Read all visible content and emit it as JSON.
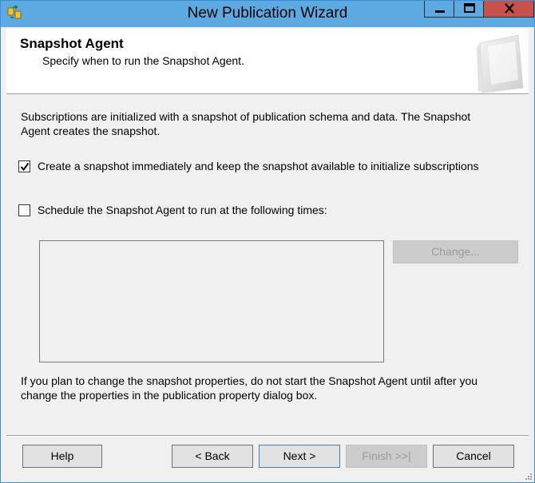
{
  "window": {
    "title": "New Publication Wizard",
    "accent_color": "#5da9e1",
    "close_color": "#c7514b",
    "controls": [
      "minimize-icon",
      "maximize-icon",
      "close-icon"
    ]
  },
  "header": {
    "title": "Snapshot Agent",
    "subtitle": "Specify when to run the Snapshot Agent."
  },
  "content": {
    "intro": "Subscriptions are initialized with a snapshot of publication schema and data. The Snapshot Agent creates the snapshot.",
    "option_immediate": {
      "label": "Create a snapshot immediately and keep the snapshot available to initialize subscriptions",
      "checked": true
    },
    "option_schedule": {
      "label": "Schedule the Snapshot Agent to run at the following times:",
      "checked": false
    },
    "change_label": "Change...",
    "note": "If you plan to change the snapshot properties, do not start the Snapshot Agent until after you change the properties in the publication property dialog box."
  },
  "footer": {
    "help": "Help",
    "back": "< Back",
    "next": "Next >",
    "finish": "Finish >>|",
    "cancel": "Cancel"
  }
}
